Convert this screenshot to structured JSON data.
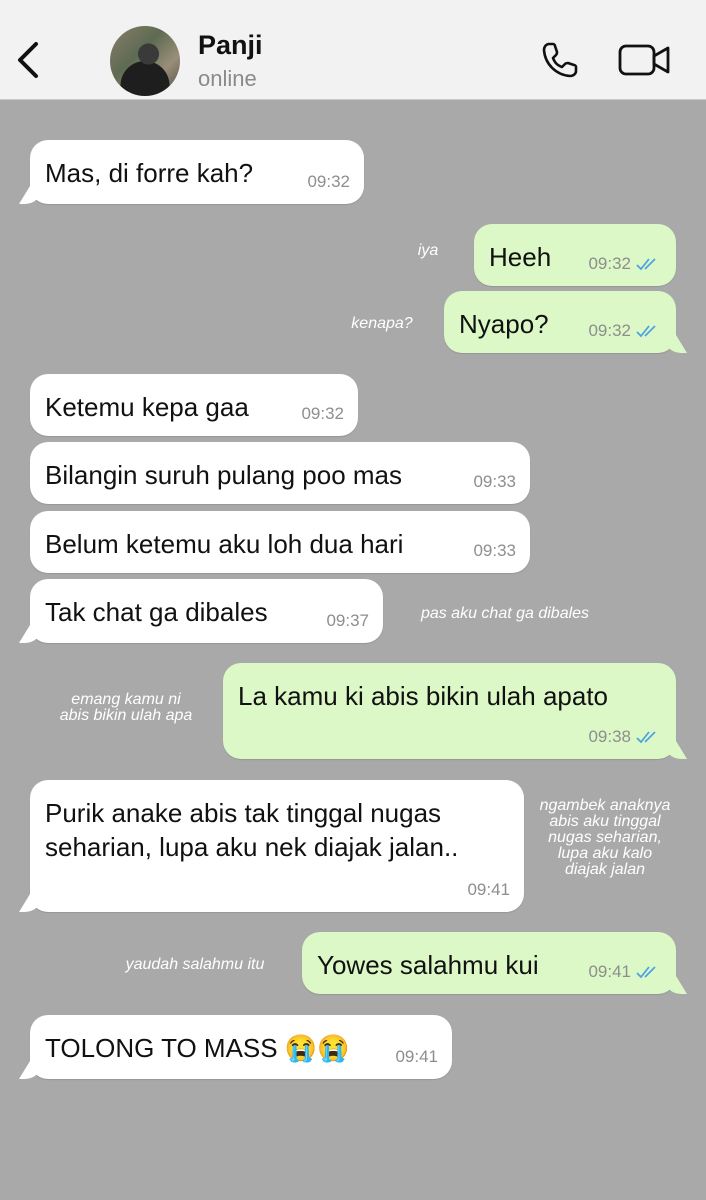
{
  "header": {
    "contact_name": "Panji",
    "status": "online",
    "icons": {
      "back": "chevron-left-icon",
      "call": "phone-icon",
      "video": "video-camera-icon"
    }
  },
  "colors": {
    "chat_background": "#a9a9a9",
    "incoming_bubble": "#ffffff",
    "outgoing_bubble": "#dcf8c6",
    "read_ticks": "#4fa3e0",
    "header_background": "#f2f2f2"
  },
  "messages": [
    {
      "direction": "in",
      "text": "Mas, di forre kah?",
      "time": "09:32"
    },
    {
      "direction": "out",
      "text": "Heeh",
      "time": "09:32",
      "status": "read"
    },
    {
      "direction": "out",
      "text": "Nyapo?",
      "time": "09:32",
      "status": "read"
    },
    {
      "direction": "in",
      "text": "Ketemu kepa gaa",
      "time": "09:32"
    },
    {
      "direction": "in",
      "text": "Bilangin suruh pulang poo mas",
      "time": "09:33"
    },
    {
      "direction": "in",
      "text": "Belum ketemu aku loh dua hari",
      "time": "09:33"
    },
    {
      "direction": "in",
      "text": "Tak chat ga dibales",
      "time": "09:37"
    },
    {
      "direction": "out",
      "text": "La kamu ki abis bikin ulah apato",
      "time": "09:38",
      "status": "read"
    },
    {
      "direction": "in",
      "text": "Purik anake abis tak tinggal nugas\nseharian, lupa aku nek diajak jalan..",
      "time": "09:41"
    },
    {
      "direction": "out",
      "text": "Yowes salahmu kui",
      "time": "09:41",
      "status": "read"
    },
    {
      "direction": "in",
      "text": "TOLONG TO MASS 😭😭",
      "time": "09:41"
    }
  ],
  "annotations": [
    {
      "text": "iya"
    },
    {
      "text": "kenapa?"
    },
    {
      "text": "pas aku chat ga dibales"
    },
    {
      "text": "emang kamu ni\nabis bikin ulah apa"
    },
    {
      "text": "ngambek anaknya\nabis aku tinggal\nnugas seharian,\nlupa aku kalo\ndiajak jalan"
    },
    {
      "text": "yaudah salahmu itu"
    }
  ]
}
